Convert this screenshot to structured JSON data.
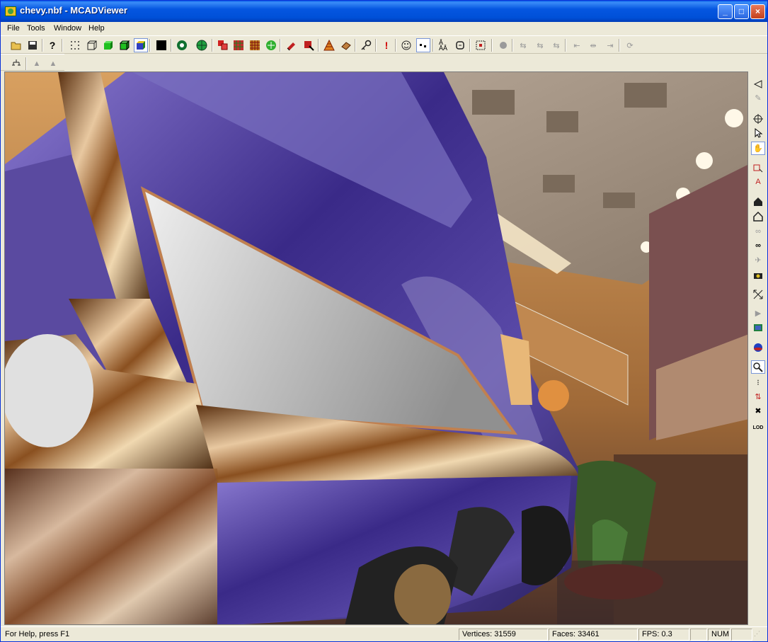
{
  "window": {
    "title": "chevy.nbf - MCADViewer"
  },
  "menu": [
    "File",
    "Tools",
    "Window",
    "Help"
  ],
  "toolbar_icons": [
    "open-icon",
    "save-icon",
    "help-icon",
    "points-icon",
    "wireframe-icon",
    "shaded-icon",
    "shaded-edges-icon",
    "textured-icon",
    "background-icon",
    "environment-icon",
    "sphere-map-icon",
    "material-icon",
    "texture-icon",
    "pattern-icon",
    "grid-icon",
    "paint-icon",
    "decal-icon",
    "triangle-icon",
    "eraser-icon",
    "key-icon",
    "alert-icon",
    "smile-icon",
    "dots-icon",
    "text-icon",
    "cycle-icon",
    "frame-icon",
    "record-icon",
    "anim-1-icon",
    "anim-2-icon",
    "anim-3-icon",
    "anim-4-icon",
    "anim-5-icon",
    "anim-6-icon",
    "anim-7-icon"
  ],
  "toolbar2_icons": [
    "tree-icon",
    "boot-icon",
    "boot-2-icon"
  ],
  "right_icons": [
    "nav-left-icon",
    "nav-2-icon",
    "target-icon",
    "pointer-icon",
    "hand-icon",
    "box-select-icon",
    "measure-icon",
    "home-plus-icon",
    "home-icon",
    "walk-icon",
    "binoculars-icon",
    "fly-icon",
    "camera-icon",
    "fit-icon",
    "play-icon",
    "film-icon",
    "globe-icon",
    "zoom-icon",
    "footsteps-icon",
    "split-icon",
    "tools-icon",
    "lod-icon"
  ],
  "right_lod_label": "LOD",
  "status": {
    "help": "For Help, press F1",
    "vertices": "Vertices: 31559",
    "faces": "Faces: 33461",
    "fps": "FPS: 0.3",
    "num": "NUM"
  }
}
